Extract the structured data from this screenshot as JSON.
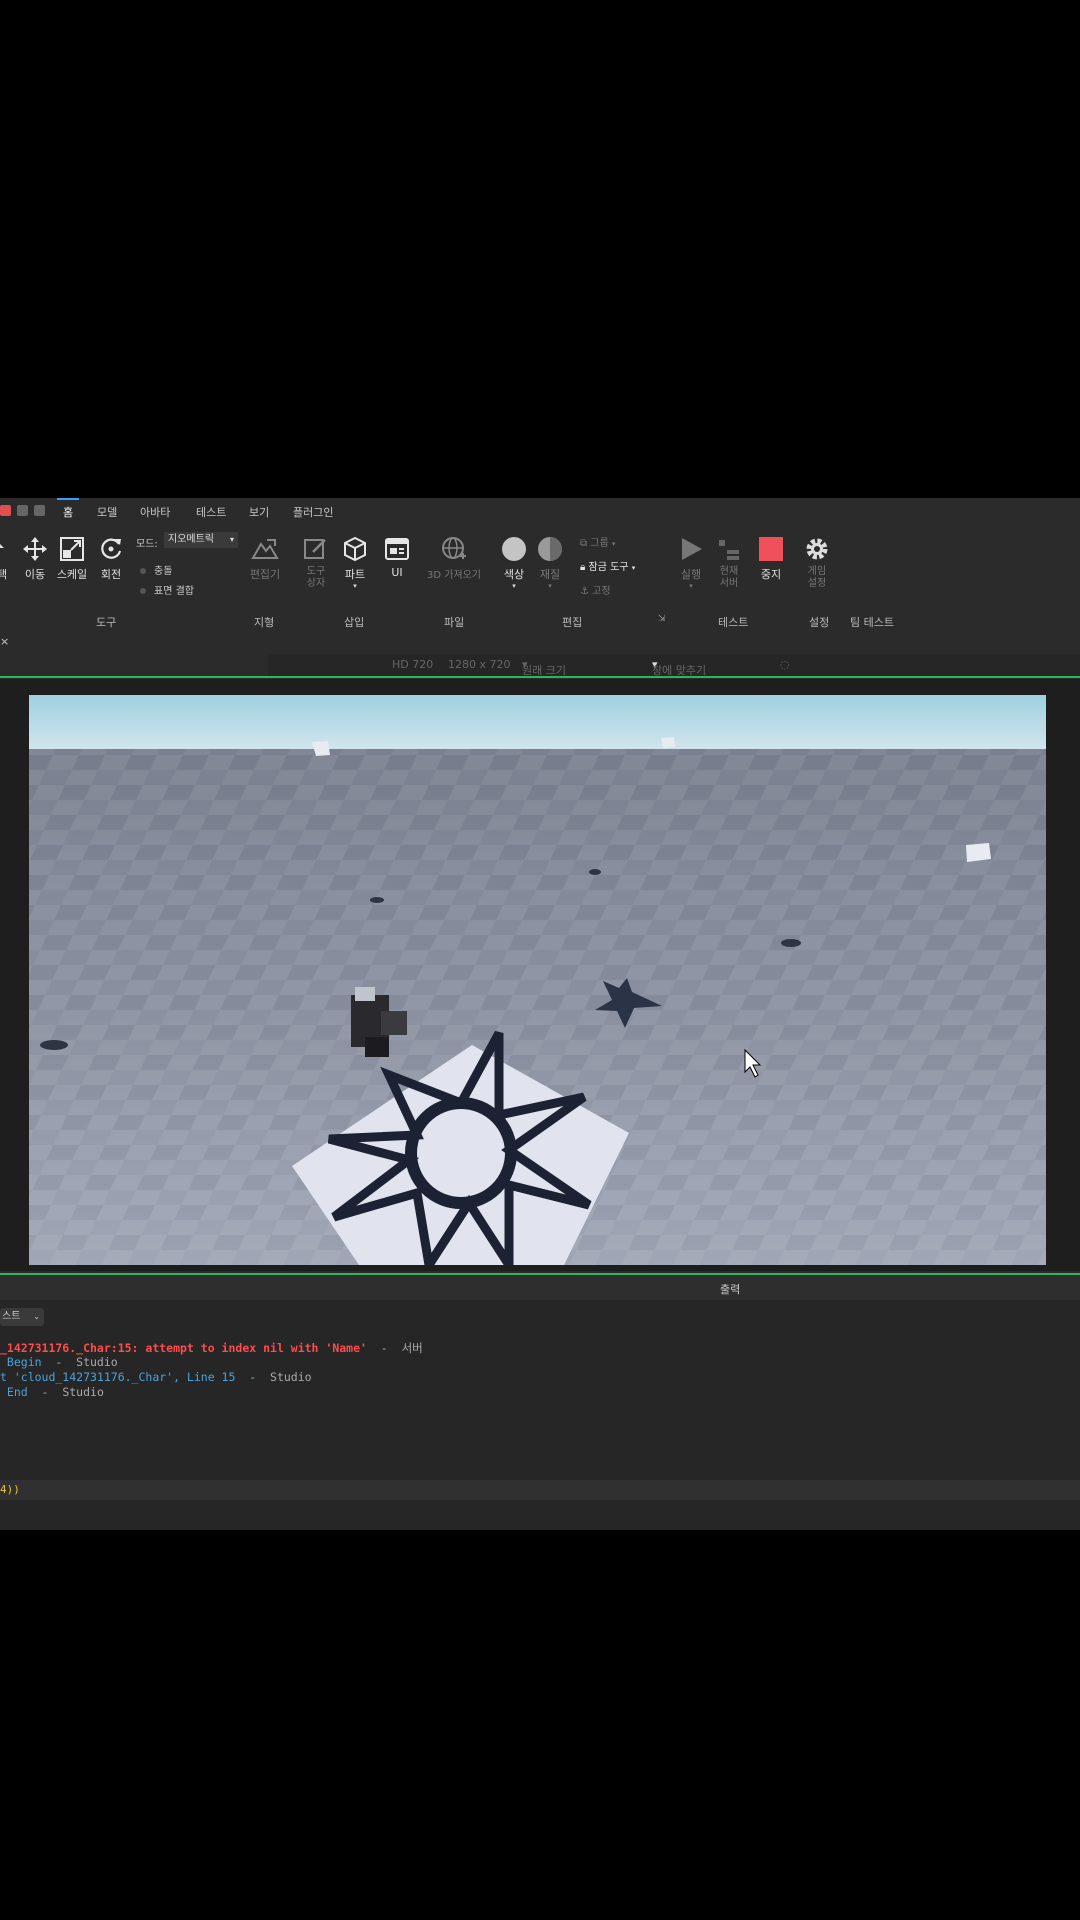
{
  "menu": {
    "tabs": [
      {
        "label": "홈"
      },
      {
        "label": "모델"
      },
      {
        "label": "아바타"
      },
      {
        "label": "테스트"
      },
      {
        "label": "보기"
      },
      {
        "label": "플러그인"
      }
    ]
  },
  "ribbon": {
    "tools": {
      "move": "이동",
      "scale": "스케일",
      "rotate": "회전",
      "mode_label": "모드:",
      "mode_value": "지오메트릭",
      "collision": "충돌",
      "join_surfaces": "표면 결합",
      "terrain_editor": "편집기",
      "toolbox": "도구 상자",
      "part": "파트",
      "ui": "UI",
      "import_3d": "3D 가져오기",
      "color": "색상",
      "material": "재질",
      "group": "그룹",
      "lock_tool": "잠금 도구",
      "anchor": "고정",
      "play": "실행",
      "current_server": "현재 서버",
      "stop": "중지",
      "game_settings": "게임 설정"
    },
    "groups": {
      "tools": "도구",
      "terrain": "지형",
      "insert": "삽입",
      "file": "파일",
      "edit": "편집",
      "test": "테스트",
      "settings": "설정",
      "team_test": "팀 테스트"
    }
  },
  "device_bar": {
    "resolution": "HD 720",
    "size": "1280 x 720",
    "ratio": "원래 크기",
    "fit": "창에 맞추기"
  },
  "output": {
    "title": "출력",
    "filter": "스트",
    "lines": [
      {
        "text": "_142731176._Char:15: attempt to index nil with 'Name'  -  서버",
        "kind": "error"
      },
      {
        "text": " Begin  -  Studio",
        "kind": "info"
      },
      {
        "text": "t 'cloud_142731176._Char', Line 15  -  Studio",
        "kind": "info"
      },
      {
        "text": " End  -  Studio",
        "kind": "info"
      }
    ],
    "command": "4))"
  },
  "colors": {
    "accent": "#3c9bff",
    "border_green": "#2fb45a",
    "error": "#ff4b4b",
    "info": "#4aa3d8",
    "stop": "#f0505a"
  }
}
